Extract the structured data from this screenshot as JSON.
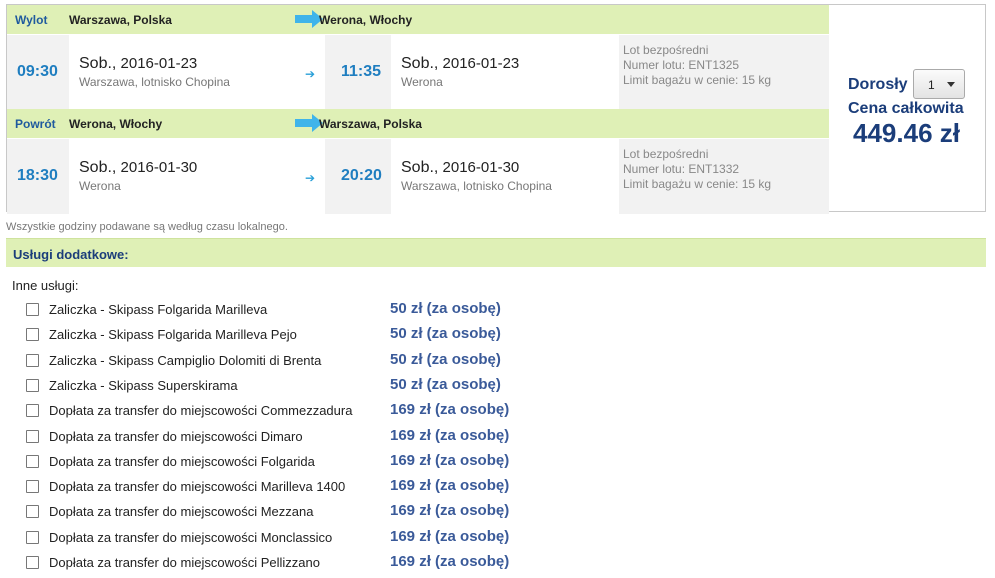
{
  "outbound": {
    "direction": "Wylot",
    "from": "Warszawa, Polska",
    "to": "Werona, Włochy",
    "dep_time": "09:30",
    "dep_day": "Sob.,",
    "dep_date": "2016-01-23",
    "dep_place": "Warszawa, lotnisko Chopina",
    "arr_time": "11:35",
    "arr_day": "Sob.,",
    "arr_date": "2016-01-23",
    "arr_place": "Werona",
    "info1": "Lot bezpośredni",
    "info2": "Numer lotu: ENT1325",
    "info3": "Limit bagażu w cenie: 15 kg"
  },
  "return": {
    "direction": "Powrót",
    "from": "Werona, Włochy",
    "to": "Warszawa, Polska",
    "dep_time": "18:30",
    "dep_day": "Sob.,",
    "dep_date": "2016-01-30",
    "dep_place": "Werona",
    "arr_time": "20:20",
    "arr_day": "Sob.,",
    "arr_date": "2016-01-30",
    "arr_place": "Warszawa, lotnisko Chopina",
    "info1": "Lot bezpośredni",
    "info2": "Numer lotu: ENT1332",
    "info3": "Limit bagażu w cenie: 15 kg"
  },
  "price": {
    "pax_label": "Dorosły",
    "pax_value": "1",
    "total_label": "Cena całkowita",
    "total_value": "449.46 zł"
  },
  "note": "Wszystkie godziny podawane są według czasu lokalnego.",
  "services": {
    "title": "Usługi dodatkowe:",
    "other_label": "Inne usługi:",
    "items": [
      {
        "name": "Zaliczka - Skipass Folgarida Marilleva",
        "price": "50 zł (za osobę)"
      },
      {
        "name": "Zaliczka - Skipass Folgarida Marilleva Pejo",
        "price": "50 zł (za osobę)"
      },
      {
        "name": "Zaliczka - Skipass Campiglio Dolomiti di Brenta",
        "price": "50 zł (za osobę)"
      },
      {
        "name": "Zaliczka - Skipass Superskirama",
        "price": "50 zł (za osobę)"
      },
      {
        "name": "Dopłata za transfer do miejscowości Commezzadura",
        "price": "169 zł (za osobę)"
      },
      {
        "name": "Dopłata za transfer do miejscowości Dimaro",
        "price": "169 zł (za osobę)"
      },
      {
        "name": "Dopłata za transfer do miejscowości Folgarida",
        "price": "169 zł (za osobę)"
      },
      {
        "name": "Dopłata za transfer do miejscowości Marilleva 1400",
        "price": "169 zł (za osobę)"
      },
      {
        "name": "Dopłata za transfer do miejscowości Mezzana",
        "price": "169 zł (za osobę)"
      },
      {
        "name": "Dopłata za transfer do miejscowości Monclassico",
        "price": "169 zł (za osobę)"
      },
      {
        "name": "Dopłata za transfer do miejscowości Pellizzano",
        "price": "169 zł (za osobę)"
      }
    ]
  },
  "colors": {
    "header_green": "#dff0b6",
    "time_blue": "#1f7ec0",
    "price_navy": "#1b3d7a",
    "service_price": "#3a5a99"
  },
  "icons": {
    "route_arrow": "arrow-right-icon",
    "segment_arrow": "small-arrow-right-icon",
    "select_caret": "chevron-down-icon",
    "checkbox": "checkbox-icon"
  }
}
